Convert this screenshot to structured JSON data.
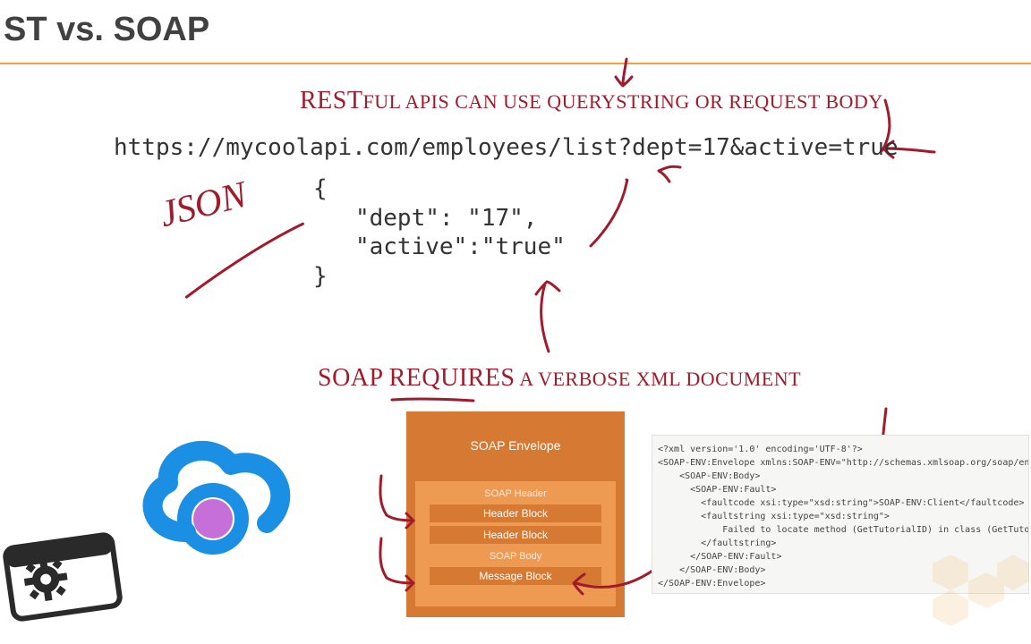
{
  "title": "ST vs. SOAP",
  "rest_caption": {
    "bigA": "REST",
    "smallA": "FUL API",
    "smallB": "S CAN USE QUERYSTRING OR REQUEST BODY"
  },
  "url": "https://mycoolapi.com/employees/list?dept=17&active=true",
  "json_label": "JSON",
  "json_body": "{\n   \"dept\": \"17\",\n   \"active\":\"true\"\n}",
  "soap_caption": {
    "word1": "SOAP",
    "word2": "REQUIRES",
    "rest": " A VERBOSE XML DOCUMENT"
  },
  "envelope": {
    "title": "SOAP Envelope",
    "header_label": "SOAP Header",
    "header_block1": "Header Block",
    "header_block2": "Header Block",
    "body_label": "SOAP Body",
    "body_block": "Message Block"
  },
  "xml": "<?xml version='1.0' encoding='UTF-8'?>\n<SOAP-ENV:Envelope xmlns:SOAP-ENV=\"http://schemas.xmlsoap.org/soap/envelope/\"\n    <SOAP-ENV:Body>\n      <SOAP-ENV:Fault>\n        <faultcode xsi:type=\"xsd:string\">SOAP-ENV:Client</faultcode>\n        <faultstring xsi:type=\"xsd:string\">\n            Failed to locate method (GetTutorialID) in class (GetTutorial)\n        </faultstring>\n      </SOAP-ENV:Fault>\n    </SOAP-ENV:Body>\n</SOAP-ENV:Envelope>"
}
